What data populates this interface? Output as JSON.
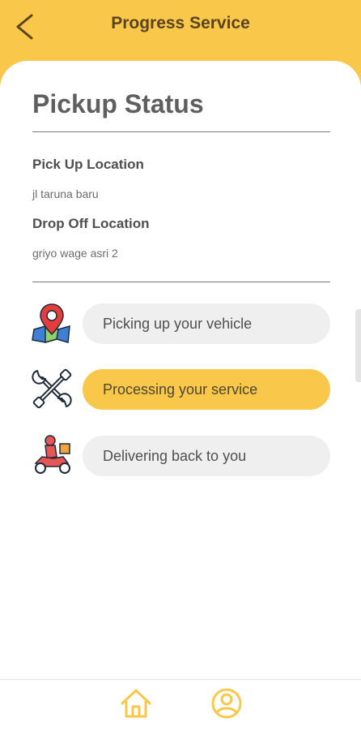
{
  "header": {
    "title": "Progress Service",
    "back_icon": "chevron-left-icon"
  },
  "page": {
    "title": "Pickup Status"
  },
  "pickup": {
    "label": "Pick Up Location",
    "value": "jl taruna baru"
  },
  "dropoff": {
    "label": "Drop Off Location",
    "value": "griyo wage asri 2"
  },
  "steps": [
    {
      "icon": "map-pin-icon",
      "label": "Picking up your vehicle",
      "active": false
    },
    {
      "icon": "tools-icon",
      "label": "Processing your service",
      "active": true
    },
    {
      "icon": "delivery-scooter-icon",
      "label": "Delivering back to you",
      "active": false
    }
  ],
  "bottom_nav": [
    {
      "icon": "home-icon"
    },
    {
      "icon": "profile-icon"
    }
  ],
  "colors": {
    "accent": "#f9c84b",
    "pill_inactive": "#efefef",
    "text_dark": "#4f4f4f"
  }
}
